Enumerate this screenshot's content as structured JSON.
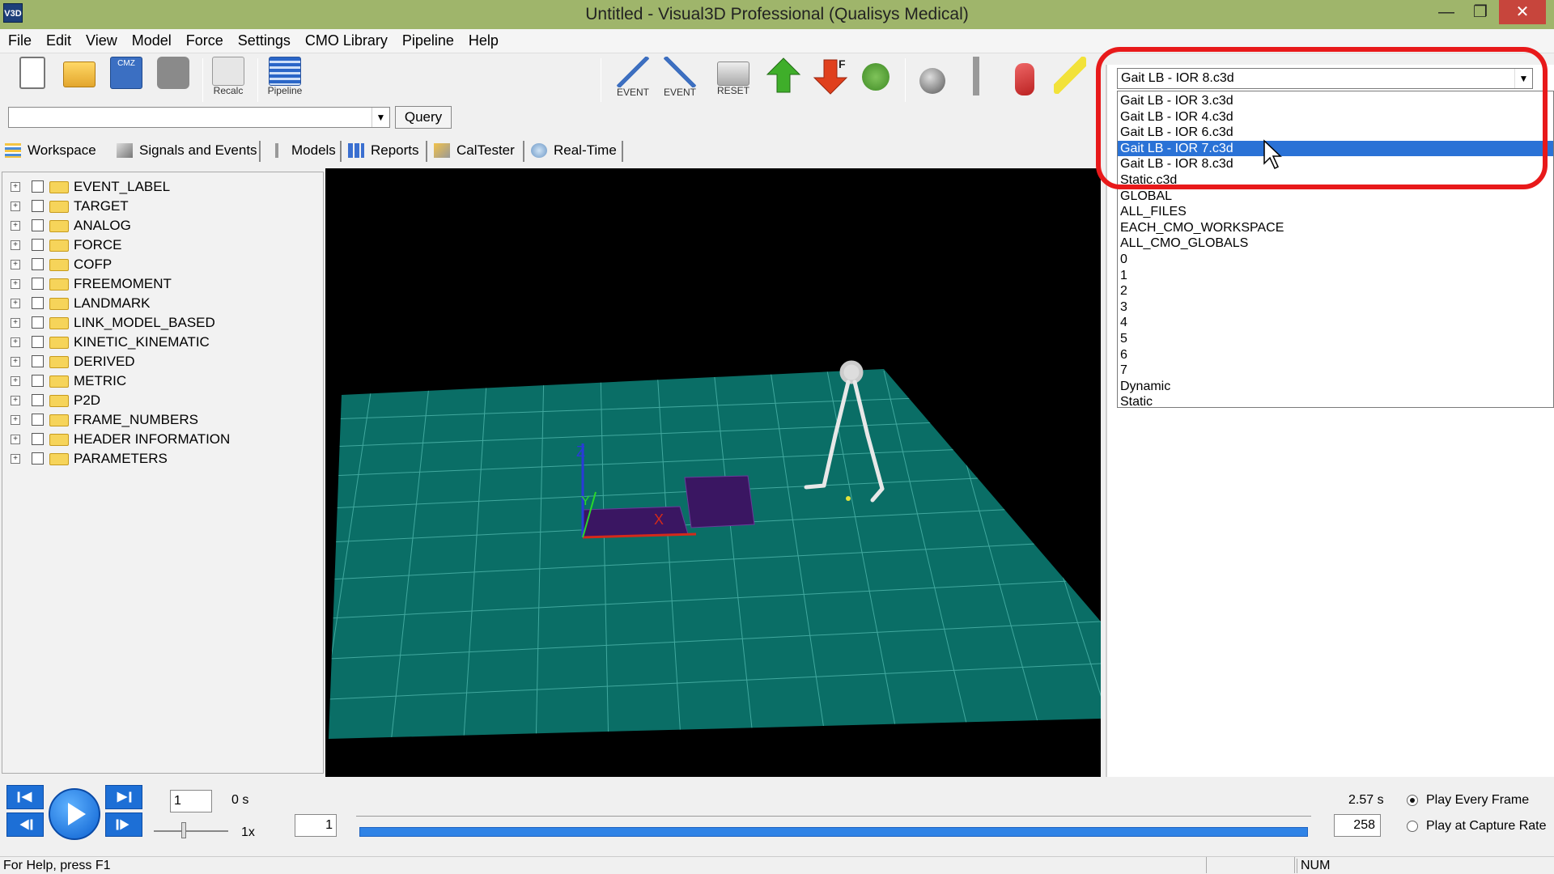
{
  "window": {
    "title": "Untitled - Visual3D Professional (Qualisys Medical)",
    "app_icon": "V3D",
    "minimize_glyph": "—",
    "restore_glyph": "❐",
    "close_glyph": "✕"
  },
  "menu": [
    "File",
    "Edit",
    "View",
    "Model",
    "Force",
    "Settings",
    "CMO Library",
    "Pipeline",
    "Help"
  ],
  "toolbar": {
    "recalc": "Recalc",
    "pipeline": "Pipeline",
    "event1": "EVENT",
    "event2": "EVENT",
    "reset": "RESET",
    "cmz_label": "CMZ",
    "force_badge": "F"
  },
  "query": {
    "value": "",
    "button": "Query"
  },
  "tabs": [
    "Workspace",
    "Signals and Events",
    "Models",
    "Reports",
    "CalTester",
    "Real-Time"
  ],
  "tree": [
    "EVENT_LABEL",
    "TARGET",
    "ANALOG",
    "FORCE",
    "COFP",
    "FREEMOMENT",
    "LANDMARK",
    "LINK_MODEL_BASED",
    "KINETIC_KINEMATIC",
    "DERIVED",
    "METRIC",
    "P2D",
    "FRAME_NUMBERS",
    "HEADER INFORMATION",
    "PARAMETERS"
  ],
  "tree_expander": "+",
  "file_combo": {
    "selected": "Gait LB - IOR 8.c3d",
    "options": [
      "Gait LB - IOR 3.c3d",
      "Gait LB - IOR 4.c3d",
      "Gait LB - IOR 6.c3d",
      "Gait LB - IOR 7.c3d",
      "Gait LB - IOR 8.c3d",
      "Static.c3d",
      "GLOBAL",
      "ALL_FILES",
      "EACH_CMO_WORKSPACE",
      "ALL_CMO_GLOBALS",
      "0",
      "1",
      "2",
      "3",
      "4",
      "5",
      "6",
      "7",
      "Dynamic",
      "Static"
    ],
    "highlighted": "Gait LB - IOR 7.c3d"
  },
  "viewport": {
    "axis_z": "Z",
    "axis_y": "Y",
    "axis_x": "X",
    "floor_color": "#0a6e66",
    "plate_color": "#3a1662"
  },
  "playback": {
    "frame_field": "1",
    "time_start": "0 s",
    "speed": "1x",
    "start_frame": "1",
    "end_time": "2.57 s",
    "end_frame": "258",
    "mode_every_frame": "Play Every Frame",
    "mode_capture_rate": "Play at Capture Rate",
    "mode_selected": "Play Every Frame"
  },
  "status": {
    "help": "For Help, press F1",
    "num": "NUM"
  }
}
